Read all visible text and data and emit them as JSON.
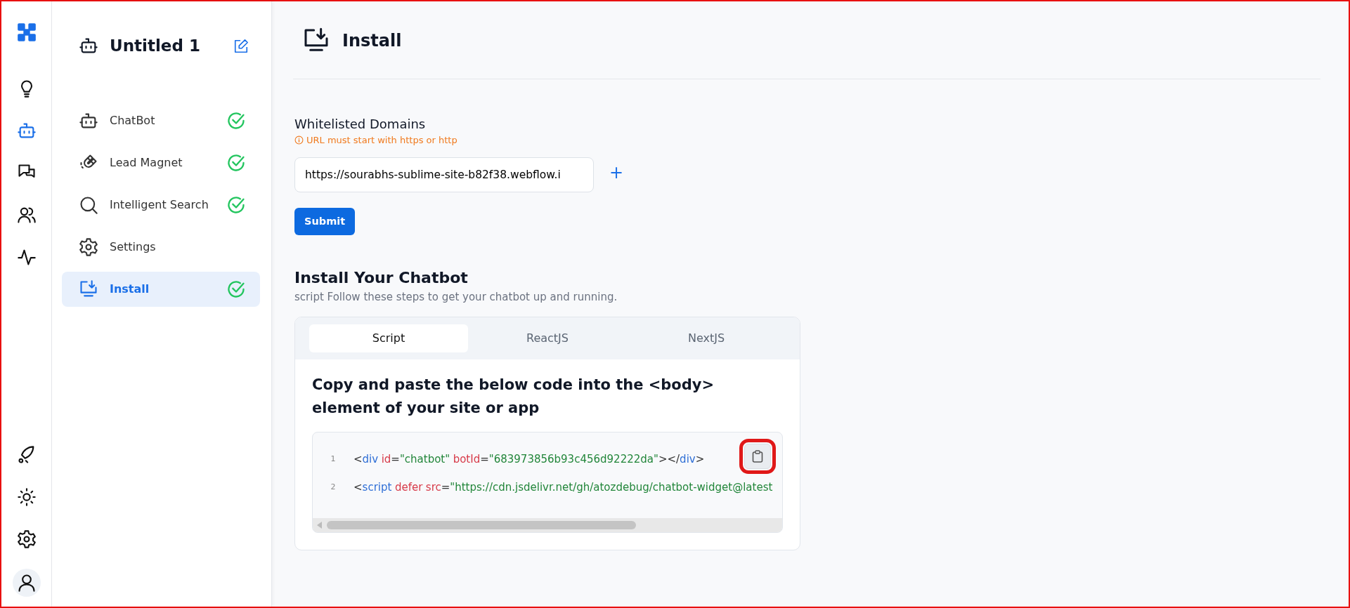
{
  "rail": {
    "top": [
      {
        "kind": "logo"
      },
      {
        "kind": "bulb",
        "selected": false
      },
      {
        "kind": "bot",
        "selected": true
      },
      {
        "kind": "chat",
        "selected": false
      },
      {
        "kind": "users",
        "selected": false
      },
      {
        "kind": "pulse",
        "selected": false
      }
    ],
    "bottom": [
      {
        "kind": "rocket",
        "selected": false
      },
      {
        "kind": "sun",
        "selected": false
      },
      {
        "kind": "gear",
        "selected": false
      },
      {
        "kind": "avatar",
        "selected": false
      }
    ]
  },
  "sidebar": {
    "title": "Untitled 1",
    "items": [
      {
        "kind": "bot",
        "label": "ChatBot",
        "done": true,
        "selected": false
      },
      {
        "kind": "magnet",
        "label": "Lead Magnet",
        "done": true,
        "selected": false
      },
      {
        "kind": "search",
        "label": "Intelligent Search",
        "done": true,
        "selected": false
      },
      {
        "kind": "gear",
        "label": "Settings",
        "done": false,
        "selected": false
      },
      {
        "kind": "install",
        "label": "Install",
        "done": true,
        "selected": true
      }
    ]
  },
  "page": {
    "title": "Install"
  },
  "domains": {
    "label": "Whitelisted Domains",
    "hint": "URL must start with https or http",
    "value": "https://sourabhs-sublime-site-b82f38.webflow.i",
    "add": "+",
    "submit": "Submit"
  },
  "install": {
    "title": "Install Your Chatbot",
    "subtitle": "script Follow these steps to get your chatbot up and running.",
    "tabs": [
      {
        "label": "Script",
        "selected": true
      },
      {
        "label": "ReactJS",
        "selected": false
      },
      {
        "label": "NextJS",
        "selected": false
      }
    ],
    "instruction": "Copy and paste the below code into the <body> element of your site or app",
    "copy_highlighted": true,
    "code_lines": [
      {
        "number": "1",
        "tokens": [
          {
            "kind": "punct",
            "text": "<"
          },
          {
            "kind": "tag",
            "text": "div"
          },
          {
            "kind": "attr",
            "text": "id"
          },
          {
            "kind": "punct",
            "text": "="
          },
          {
            "kind": "string",
            "text": "\"chatbot\""
          },
          {
            "kind": "attr",
            "text": "botId"
          },
          {
            "kind": "punct",
            "text": "="
          },
          {
            "kind": "string",
            "text": "\"683973856b93c456d92222da\""
          },
          {
            "kind": "punct",
            "text": "></"
          },
          {
            "kind": "tag",
            "text": "div"
          },
          {
            "kind": "punct",
            "text": ">"
          }
        ]
      },
      {
        "number": "2",
        "tokens": [
          {
            "kind": "punct",
            "text": "<"
          },
          {
            "kind": "tag",
            "text": "script"
          },
          {
            "kind": "attr",
            "text": "defer"
          },
          {
            "kind": "attr",
            "text": "src"
          },
          {
            "kind": "punct",
            "text": "="
          },
          {
            "kind": "string",
            "text": "\"https://cdn.jsdelivr.net/gh/atozdebug/chatbot-widget@latest"
          }
        ]
      }
    ]
  }
}
